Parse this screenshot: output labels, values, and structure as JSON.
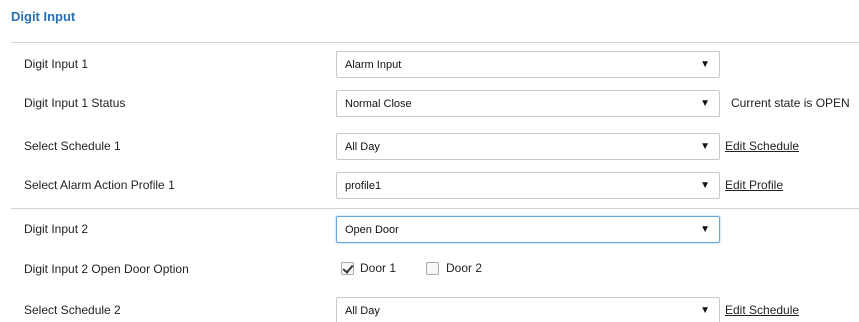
{
  "section": {
    "title": "Digit Input"
  },
  "rows": [
    {
      "label": "Digit Input 1",
      "value": "Alarm Input"
    },
    {
      "label": "Digit Input 1 Status",
      "value": "Normal Close",
      "note": "Current state is OPEN"
    },
    {
      "label": "Select Schedule 1",
      "value": "All Day",
      "link": "Edit Schedule"
    },
    {
      "label": "Select Alarm Action Profile 1",
      "value": "profile1",
      "link": "Edit Profile"
    },
    {
      "label": "Digit Input 2",
      "value": "Open Door"
    },
    {
      "label": "Digit Input 2 Open Door Option",
      "options": [
        {
          "label": "Door 1",
          "checked": true
        },
        {
          "label": "Door 2",
          "checked": false
        }
      ]
    },
    {
      "label": "Select Schedule 2",
      "value": "All Day",
      "link": "Edit Schedule"
    }
  ],
  "icons": {
    "dropdown": "▼"
  },
  "colors": {
    "title": "#2a6fb0",
    "focus_border": "#66a3dd"
  }
}
